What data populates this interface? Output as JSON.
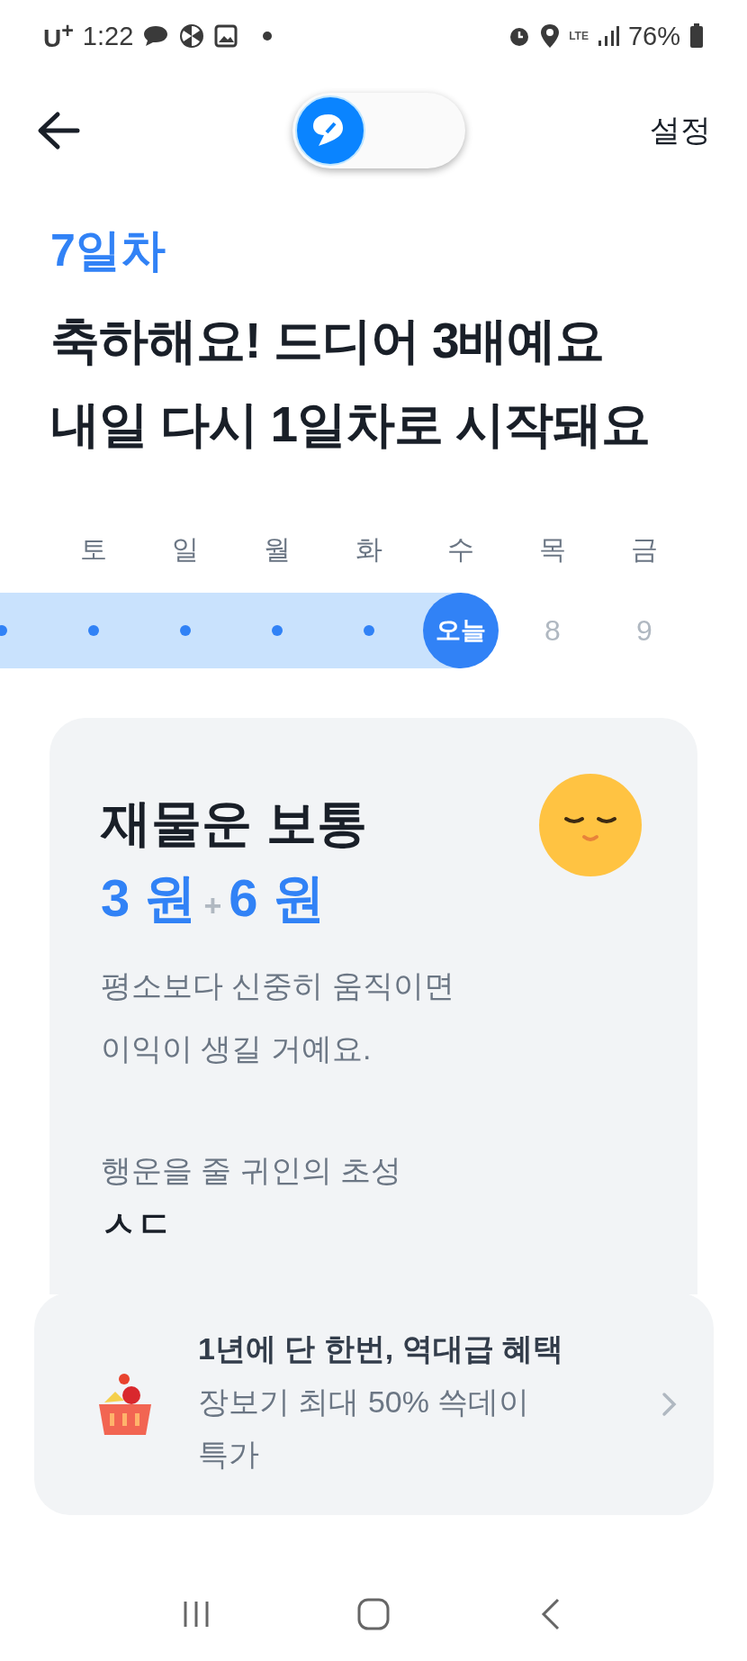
{
  "status_bar": {
    "carrier": "U$^{+}$",
    "time": "1:22",
    "network": "LTE",
    "battery": "76%"
  },
  "header": {
    "toggle": {
      "on": false
    },
    "settings": "설정"
  },
  "day_label": "7일차",
  "headline": [
    "축하해요! 드디어 3배예요",
    "내일 다시 1일차로 시작돼요"
  ],
  "week": [
    {
      "kind": "past"
    },
    {
      "day": "토",
      "kind": "past"
    },
    {
      "day": "일",
      "kind": "past"
    },
    {
      "day": "월",
      "kind": "past"
    },
    {
      "day": "화",
      "kind": "past"
    },
    {
      "day": "수",
      "kind": "today",
      "label": "오늘"
    },
    {
      "day": "목",
      "kind": "future",
      "label": "8"
    },
    {
      "day": "금",
      "kind": "future",
      "label": "9"
    }
  ],
  "card": {
    "title": "재물운 보통",
    "amount": "3 원",
    "plus": "+",
    "bonus": "6 원",
    "description": "평소보다 신중히 움직이면 이익이 생길 거예요.",
    "hint_label": "행운을 줄 귀인의 초성",
    "hint_value": "ㅅㄷ"
  },
  "banner": {
    "title": "1년에 단 한번, 역대급 혜택",
    "subtitle": "장보기 최대 50% 쓱데이 특가"
  }
}
